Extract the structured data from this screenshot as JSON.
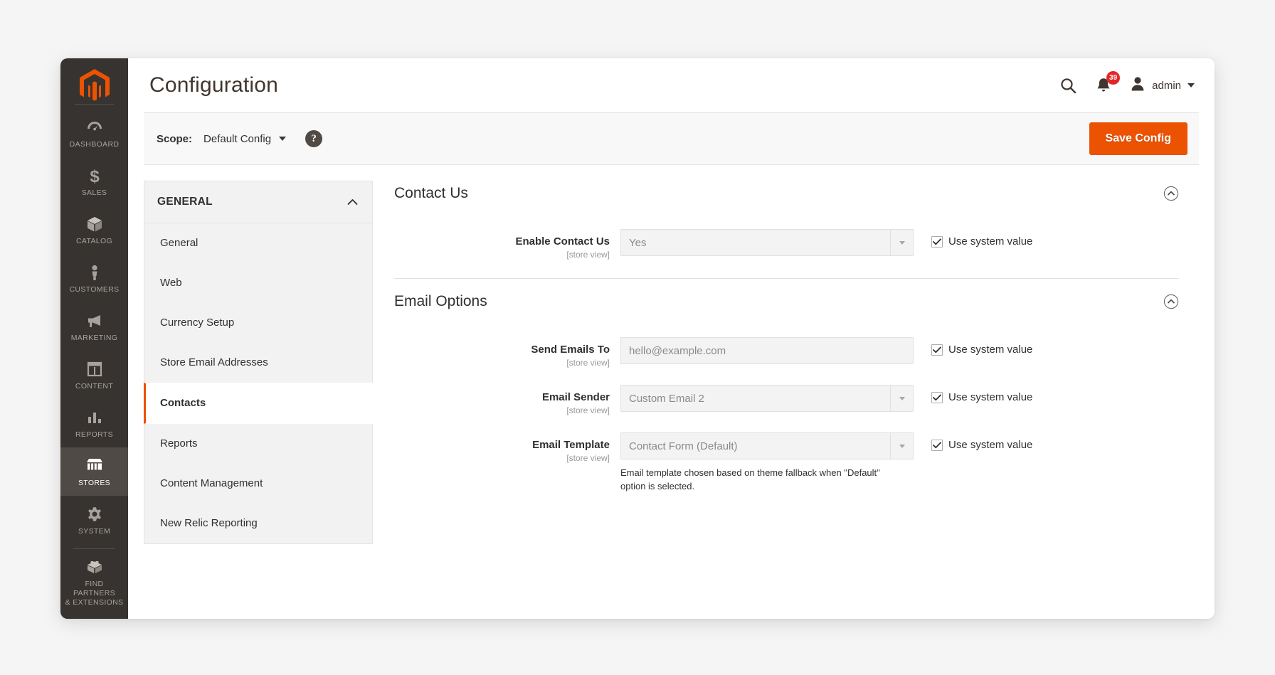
{
  "admin_menu": {
    "logo": "magento-logo-icon",
    "items": [
      {
        "label": "DASHBOARD",
        "icon": "dashboard-icon",
        "active": false
      },
      {
        "label": "SALES",
        "icon": "dollar-icon",
        "active": false
      },
      {
        "label": "CATALOG",
        "icon": "box-icon",
        "active": false
      },
      {
        "label": "CUSTOMERS",
        "icon": "person-icon",
        "active": false
      },
      {
        "label": "MARKETING",
        "icon": "megaphone-icon",
        "active": false
      },
      {
        "label": "CONTENT",
        "icon": "layout-icon",
        "active": false
      },
      {
        "label": "REPORTS",
        "icon": "bar-chart-icon",
        "active": false
      },
      {
        "label": "STORES",
        "icon": "storefront-icon",
        "active": true
      },
      {
        "label": "SYSTEM",
        "icon": "gear-icon",
        "active": false
      }
    ],
    "partners": {
      "line1": "FIND PARTNERS",
      "line2": "& EXTENSIONS",
      "icon": "lego-brick-icon"
    }
  },
  "header": {
    "title": "Configuration",
    "search_icon": "search-icon",
    "notifications_icon": "bell-icon",
    "notifications_count": "39",
    "avatar_icon": "user-avatar-icon",
    "admin_name": "admin"
  },
  "scope_bar": {
    "label": "Scope:",
    "value": "Default Config",
    "help_icon": "question-mark-icon",
    "help_glyph": "?",
    "save_label": "Save Config"
  },
  "config_nav": {
    "section_title": "GENERAL",
    "section_chevron": "chevron-up-icon",
    "items": [
      {
        "label": "General",
        "active": false
      },
      {
        "label": "Web",
        "active": false
      },
      {
        "label": "Currency Setup",
        "active": false
      },
      {
        "label": "Store Email Addresses",
        "active": false
      },
      {
        "label": "Contacts",
        "active": true
      },
      {
        "label": "Reports",
        "active": false
      },
      {
        "label": "Content Management",
        "active": false
      },
      {
        "label": "New Relic Reporting",
        "active": false
      }
    ]
  },
  "sections": [
    {
      "title": "Contact Us",
      "toggle_icon": "collapse-circle-up-icon",
      "fields": [
        {
          "label": "Enable Contact Us",
          "scope": "[store view]",
          "control": "select",
          "value": "Yes",
          "note": "",
          "use_system_value": "Use system value",
          "checked": true
        }
      ]
    },
    {
      "title": "Email Options",
      "toggle_icon": "collapse-circle-up-icon",
      "fields": [
        {
          "label": "Send Emails To",
          "scope": "[store view]",
          "control": "input",
          "value": "hello@example.com",
          "note": "",
          "use_system_value": "Use system value",
          "checked": true
        },
        {
          "label": "Email Sender",
          "scope": "[store view]",
          "control": "select",
          "value": "Custom Email 2",
          "note": "",
          "use_system_value": "Use system value",
          "checked": true
        },
        {
          "label": "Email Template",
          "scope": "[store view]",
          "control": "select",
          "value": "Contact Form (Default)",
          "note": "Email template chosen based on theme fallback when \"Default\" option is selected.",
          "use_system_value": "Use system value",
          "checked": true
        }
      ]
    }
  ],
  "colors": {
    "brand_orange": "#eb5202",
    "menu_dark": "#373330",
    "menu_active": "#4f4a46",
    "badge_red": "#e22626",
    "text_dark": "#303030"
  }
}
